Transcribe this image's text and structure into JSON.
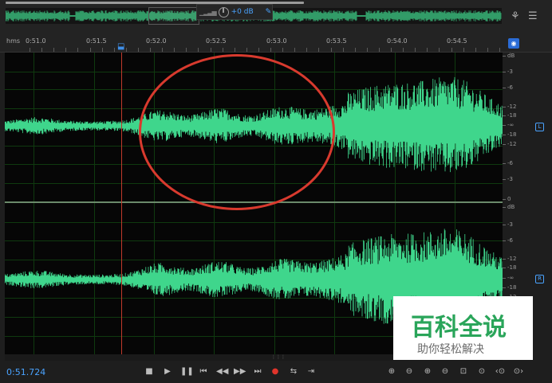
{
  "overview": {
    "gain_value": "+0 dB",
    "gain_icon": "knob-icon",
    "level_icon": "level-bars-icon",
    "pin_icon": "pin-icon",
    "mode_icon": "headphones-icon",
    "menu_icon": "menu-icon"
  },
  "ruler": {
    "unit": "hms",
    "ticks": [
      "0:51.0",
      "0:51.5",
      "0:52.0",
      "0:52.5",
      "0:53.0",
      "0:53.5",
      "0:54.0",
      "0:54.5"
    ]
  },
  "db_scale": {
    "left": {
      "channel": "L",
      "labels": [
        "dB",
        "-3",
        "-6",
        "-12",
        "-18",
        "-∞",
        "-18",
        "-12",
        "-6",
        "-3",
        "0"
      ]
    },
    "right": {
      "channel": "R",
      "labels": [
        "dB",
        "-3",
        "-6",
        "-12",
        "-18",
        "-∞",
        "-18",
        "-12",
        "-6",
        "-3",
        "0"
      ]
    }
  },
  "transport": {
    "current_time": "0:51.724",
    "buttons": [
      "stop",
      "play",
      "pause",
      "go-to-start",
      "rewind",
      "fast-forward",
      "go-to-end",
      "record",
      "loop",
      "skip"
    ]
  },
  "zoom": {
    "buttons": [
      "zoom-in-amplitude",
      "zoom-out-amplitude",
      "zoom-in-time",
      "zoom-out-time",
      "zoom-to-selection",
      "zoom-full",
      "zoom-in-left",
      "zoom-in-right"
    ]
  },
  "watermark": {
    "logo": "百科全说",
    "subtitle": "助你轻松解决"
  },
  "colors": {
    "waveform": "#3fd68c",
    "grid": "#0f3a0f",
    "playhead": "#c0392b",
    "accent": "#4aa3ff",
    "annotation": "#d83a2e",
    "watermark_green": "#2aa55a"
  }
}
